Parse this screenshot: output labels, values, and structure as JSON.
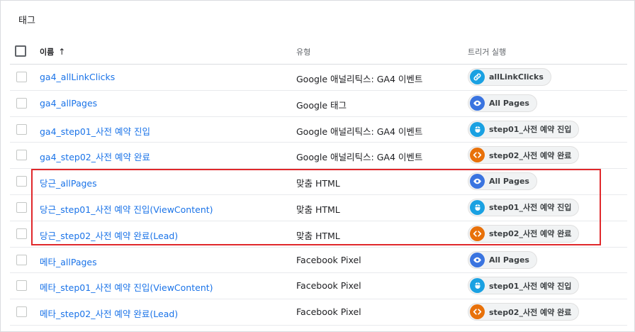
{
  "panel": {
    "title": "태그"
  },
  "header": {
    "name_label": "이름",
    "sort_arrow": "↑",
    "type_label": "유형",
    "trigger_label": "트리거 실행"
  },
  "colors": {
    "link": "#1a73e8",
    "highlight_border": "#e0282b",
    "icon_link": "#1aa1e2",
    "icon_pageview": "#3a74e0",
    "icon_click": "#1aa1e2",
    "icon_custom": "#e8710a"
  },
  "rows": [
    {
      "name": "ga4_allLinkClicks",
      "type": "Google 애널리틱스: GA4 이벤트",
      "trigger": {
        "icon": "link-icon",
        "label": "allLinkClicks"
      }
    },
    {
      "name": "ga4_allPages",
      "type": "Google 태그",
      "trigger": {
        "icon": "eye-icon",
        "label": "All Pages"
      }
    },
    {
      "name": "ga4_step01_사전 예약 진입",
      "type": "Google 애널리틱스: GA4 이벤트",
      "trigger": {
        "icon": "click-icon",
        "label": "step01_사전 예약 진입"
      }
    },
    {
      "name": "ga4_step02_사전 예약 완료",
      "type": "Google 애널리틱스: GA4 이벤트",
      "trigger": {
        "icon": "code-icon",
        "label": "step02_사전 예약 완료"
      }
    },
    {
      "name": "당근_allPages",
      "type": "맞춤 HTML",
      "trigger": {
        "icon": "eye-icon",
        "label": "All Pages"
      }
    },
    {
      "name": "당근_step01_사전 예약 진입(ViewContent)",
      "type": "맞춤 HTML",
      "trigger": {
        "icon": "click-icon",
        "label": "step01_사전 예약 진입"
      }
    },
    {
      "name": "당근_step02_사전 예약 완료(Lead)",
      "type": "맞춤 HTML",
      "trigger": {
        "icon": "code-icon",
        "label": "step02_사전 예약 완료"
      }
    },
    {
      "name": "메타_allPages",
      "type": "Facebook Pixel",
      "trigger": {
        "icon": "eye-icon",
        "label": "All Pages"
      }
    },
    {
      "name": "메타_step01_사전 예약 진입(ViewContent)",
      "type": "Facebook Pixel",
      "trigger": {
        "icon": "click-icon",
        "label": "step01_사전 예약 진입"
      }
    },
    {
      "name": "메타_step02_사전 예약 완료(Lead)",
      "type": "Facebook Pixel",
      "trigger": {
        "icon": "code-icon",
        "label": "step02_사전 예약 완료"
      }
    }
  ]
}
